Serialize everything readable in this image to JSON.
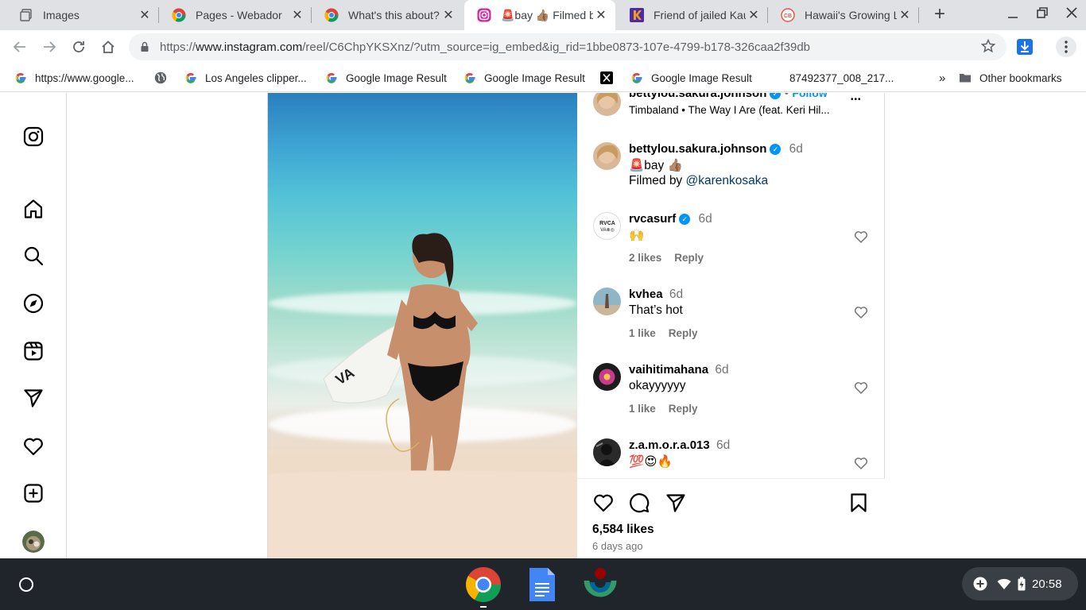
{
  "browser": {
    "tabs": [
      {
        "title": "Images",
        "favicon": "images-icon",
        "active": false
      },
      {
        "title": "Pages - Webador",
        "favicon": "chrome-icon",
        "active": false
      },
      {
        "title": "What's this about?",
        "favicon": "chrome-icon",
        "active": false
      },
      {
        "title": "🚨bay 👍🏽 Filmed b",
        "favicon": "instagram-icon",
        "active": true
      },
      {
        "title": "Friend of jailed Kau",
        "favicon": "k-icon",
        "active": false
      },
      {
        "title": "Hawaii's Growing L",
        "favicon": "cb-icon",
        "active": false
      }
    ],
    "close_glyph": "✕",
    "new_tab_glyph": "+",
    "url": {
      "scheme": "https://",
      "host": "www.instagram.com",
      "path": "/reel/C6ChpYKSXnz/?utm_source=ig_embed&ig_rid=1bbe0873-107e-4799-b178-326caa2f39db"
    },
    "bookmarks": [
      {
        "label": "https://www.google...",
        "icon": "google-icon"
      },
      {
        "label": "",
        "icon": "globe-icon"
      },
      {
        "label": "Los Angeles clipper...",
        "icon": "google-icon"
      },
      {
        "label": "Google Image Result",
        "icon": "google-icon"
      },
      {
        "label": "Google Image Result",
        "icon": "google-icon"
      },
      {
        "label": "",
        "icon": "x-icon"
      },
      {
        "label": "Google Image Result",
        "icon": "google-icon"
      },
      {
        "label": "87492377_008_217...",
        "icon": "none"
      }
    ],
    "bookmarks_overflow": "»",
    "other_bookmarks": "Other bookmarks"
  },
  "post": {
    "header": {
      "username": "bettylou.sakura.johnson",
      "follow_label": "Follow",
      "audio": "Timbaland • The Way I Are (feat. Keri Hil...",
      "more": "•••"
    },
    "caption": {
      "username": "bettylou.sakura.johnson",
      "time": "6d",
      "line1": "🚨bay 👍🏽",
      "line2_prefix": "Filmed by ",
      "mention": "@karenkosaka"
    },
    "comments": [
      {
        "username": "rvcasurf",
        "verified": true,
        "time": "6d",
        "text": "🙌",
        "likes": "2 likes",
        "reply": "Reply"
      },
      {
        "username": "kvhea",
        "verified": false,
        "time": "6d",
        "text": "That’s hot",
        "likes": "1 like",
        "reply": "Reply"
      },
      {
        "username": "vaihitimahana",
        "verified": false,
        "time": "6d",
        "text": "okayyyyyy",
        "likes": "1 like",
        "reply": "Reply"
      },
      {
        "username": "z.a.m.o.r.a.013",
        "verified": false,
        "time": "6d",
        "text": "💯😍🔥"
      }
    ],
    "likes": "6,584 likes",
    "posted": "6 days ago"
  },
  "shelf": {
    "apps": [
      "chrome-icon",
      "docs-icon",
      "wikimedia-icon"
    ],
    "time": "20:58"
  },
  "colors": {
    "accent": "#0095f6",
    "mention": "#00376b",
    "shelf": "#20252b"
  }
}
